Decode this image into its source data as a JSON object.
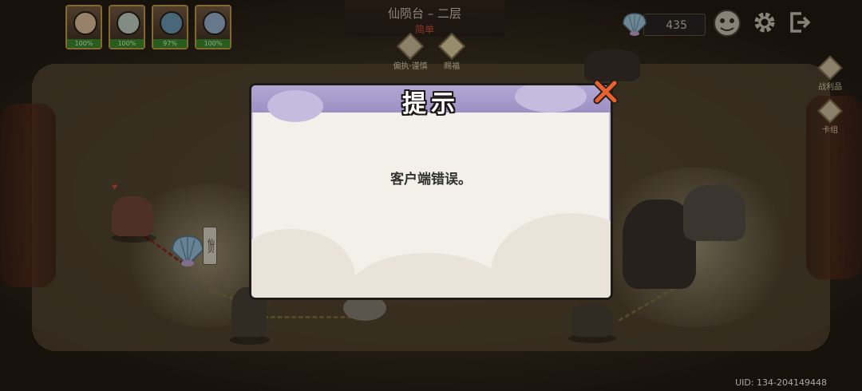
{
  "header": {
    "stage_title": "仙陨台 – 二层",
    "difficulty": "简单",
    "difficulty_color": "#d6543a"
  },
  "party": [
    {
      "hp": "100%"
    },
    {
      "hp": "100%"
    },
    {
      "hp": "97%"
    },
    {
      "hp": "100%"
    }
  ],
  "badges": [
    {
      "label": "偏执·谨慎",
      "icon": "blessing-badge-icon"
    },
    {
      "label": "赐福",
      "icon": "gift-badge-icon"
    }
  ],
  "currency": {
    "icon": "shell-icon",
    "amount": "435"
  },
  "top_icons": [
    "character-face-icon",
    "settings-gear-icon",
    "exit-icon"
  ],
  "side_menu": [
    {
      "label": "战利品"
    },
    {
      "label": "卡组"
    }
  ],
  "scene": {
    "node_tag": "仙贝"
  },
  "modal": {
    "title": "提示",
    "message": "客户端错误。",
    "header_color": "#a89cd0"
  },
  "footer": {
    "uid": "UID: 134-204149448"
  }
}
